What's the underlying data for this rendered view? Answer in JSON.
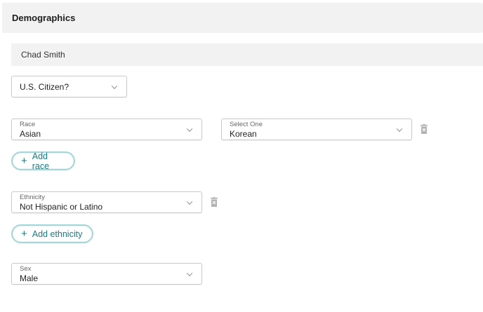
{
  "section": {
    "title": "Demographics"
  },
  "person": {
    "name": "Chad Smith"
  },
  "citizen": {
    "value": "U.S. Citizen?"
  },
  "race": {
    "label": "Race",
    "value": "Asian"
  },
  "race_detail": {
    "label": "Select One",
    "value": "Korean"
  },
  "add_race": {
    "label": "Add race"
  },
  "ethnicity": {
    "label": "Ethnicity",
    "value": "Not Hispanic or Latino"
  },
  "add_ethnicity": {
    "label": "Add ethnicity"
  },
  "sex": {
    "label": "Sex",
    "value": "Male"
  },
  "icons": {
    "dropdown": "chevron-down-icon",
    "delete": "trash-icon",
    "add": "plus-icon"
  },
  "colors": {
    "accent": "#167d85",
    "accent_border": "#a8d5d8",
    "header_bg": "#f2f2f2"
  }
}
